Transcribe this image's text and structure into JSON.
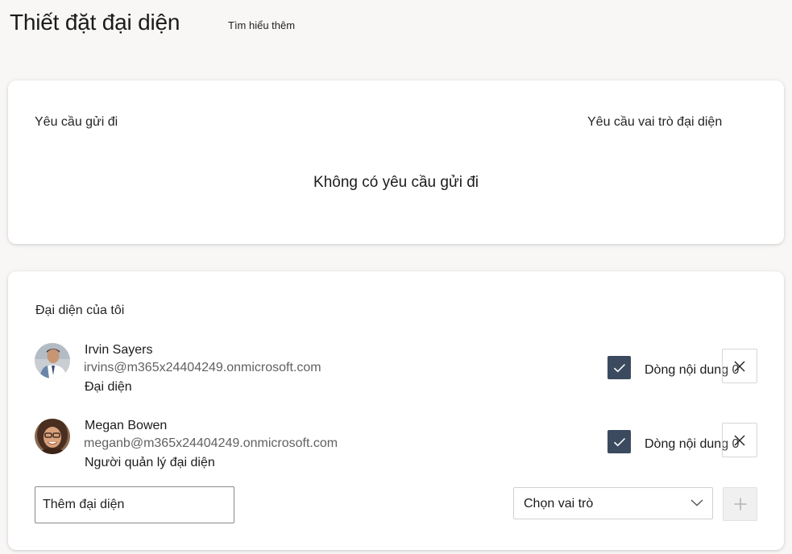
{
  "header": {
    "title": "Thiết đặt đại diện",
    "learn_more": "Tìm hiểu thêm"
  },
  "requests": {
    "outgoing_label": "Yêu cầu gửi đi",
    "role_label": "Yêu cầu vai trò đại diện",
    "empty_text": "Không có yêu cầu gửi đi"
  },
  "delegates": {
    "title": "Đại diện của tôi",
    "items": [
      {
        "name": "Irvin Sayers",
        "email": "irvins@m365x24404249.onmicrosoft.com",
        "role": "Đại diện",
        "checkbox_label": "Dòng nội dung 0",
        "checked": true,
        "avatar_icon": "person-photo-icon"
      },
      {
        "name": "Megan Bowen",
        "email": "meganb@m365x24404249.onmicrosoft.com",
        "role": "Người quản lý đại diện",
        "checkbox_label": "Dòng nội dung 0",
        "checked": true,
        "avatar_icon": "person-photo-icon"
      }
    ],
    "add_placeholder": "Thêm đại diện",
    "role_select": {
      "selected": "Chọn vai trò"
    },
    "add_button_icon": "plus-icon"
  },
  "colors": {
    "background": "#f8f7f6",
    "card": "#ffffff",
    "checkbox": "#3b4a5f",
    "muted_text": "#616161"
  }
}
